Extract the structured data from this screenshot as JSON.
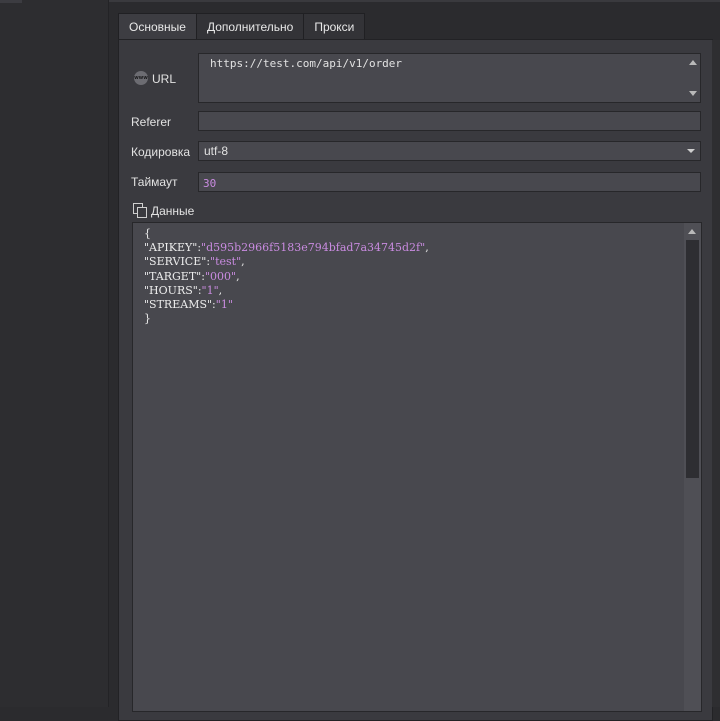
{
  "tabs": [
    {
      "label": "Основные",
      "active": true
    },
    {
      "label": "Дополнительно",
      "active": false
    },
    {
      "label": "Прокси",
      "active": false
    }
  ],
  "url": {
    "label": "URL",
    "value": "https://test.com/api/v1/order",
    "icon": "www-globe-icon"
  },
  "referer": {
    "label": "Referer",
    "value": ""
  },
  "encoding": {
    "label": "Кодировка",
    "value": "utf-8"
  },
  "timeout": {
    "label": "Таймаут",
    "value": "30"
  },
  "data": {
    "label": "Данные",
    "icon": "copy-icon",
    "open_brace": "{",
    "close_brace": "}",
    "lines": [
      {
        "key": "\"APIKEY\"",
        "value": "\"d595b2966f5183e794bfad7a34745d2f\"",
        "suffix": ","
      },
      {
        "key": "\"SERVICE\"",
        "value": "\"test\"",
        "suffix": ","
      },
      {
        "key": "\"TARGET\"",
        "value": "\"000\"",
        "suffix": ","
      },
      {
        "key": "\"HOURS\"",
        "value": "\"1\"",
        "suffix": ","
      },
      {
        "key": "\"STREAMS\"",
        "value": "\"1\"",
        "suffix": ""
      }
    ]
  },
  "colors": {
    "value_purple": "#c98be0",
    "field_bg": "#48484e",
    "panel_bg": "#3a3a3f"
  }
}
